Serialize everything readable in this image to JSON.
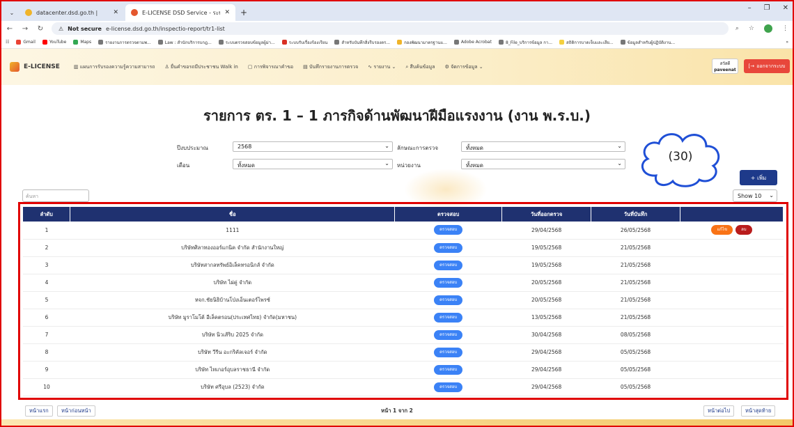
{
  "browser": {
    "tabs": [
      {
        "title": "datacenter.dsd.go.th |",
        "active": false,
        "favicon_color": "#f0b429"
      },
      {
        "title": "E-LICENSE DSD Service - ระบบกำ",
        "active": true,
        "favicon_color": "#e4572e"
      }
    ],
    "new_tab": "+",
    "address": {
      "security": "Not secure",
      "url": "e-license.dsd.go.th/inspectio-report/tr1-list"
    },
    "bookmarks": [
      "Gmail",
      "YouTube",
      "Maps",
      "รายงานการตรวจตามพ...",
      "Law : สำนักบริการบกฎ...",
      "ระบบตรวจสอบข้อมูลผู้ม่า...",
      "ระบบรับเรื่องร้องเรียน",
      "สำหรับบันทึกสิ่งรีบรองตร...",
      "กองพัฒนามาตรฐานแ...",
      "Adobe Acrobat",
      "8_File_บริการข้อมูล กา...",
      "สถิติการบาดเจ็บและเสีย...",
      "ข้อมูลสำหรับผู้ปฏิบัติงาน..."
    ],
    "bookmarks_more": "»"
  },
  "app": {
    "logo": "E-LICENSE",
    "menu": [
      "แผนการรับรองความรู้ความสามารถ",
      "ยื่นคำขอรถมีประชาชน Walk in",
      "การพิจารณาคำขอ",
      "บันทึกรายงานการตรวจ",
      "รายงาน",
      "สืบค้นข้อมูล",
      "จัดการข้อมูล"
    ],
    "user_label": "สวัสดี",
    "user_name": "paveenat",
    "logout": "ออกจากระบบ"
  },
  "page": {
    "title": "รายการ ตร. 1 – 1 ภารกิจด้านพัฒนาฝีมือแรงงาน (งาน พ.ร.บ.)",
    "filters": {
      "year_label": "ปีงบประมาณ",
      "year_value": "2568",
      "type_label": "ลักษณะการตรวจ",
      "type_value": "ทั้งหมด",
      "month_label": "เดือน",
      "month_value": "ทั้งหมด",
      "unit_label": "หน่วยงาน",
      "unit_value": "ทั้งหมด"
    },
    "annotation": "(30)",
    "add_button": "+ เพิ่ม",
    "search_placeholder": "ค้นหา",
    "show": "Show 10"
  },
  "table": {
    "headers": [
      "ลำดับ",
      "ชื่อ",
      "ตรวจสอบ",
      "วันที่ออกตรวจ",
      "วันที่บันทึก",
      ""
    ],
    "check_label": "ตรวจสอบ",
    "edit_label": "แก้ไข",
    "delete_label": "ลบ",
    "rows": [
      {
        "no": "1",
        "name": "1111",
        "inspect_date": "29/04/2568",
        "record_date": "26/05/2568",
        "actions": true
      },
      {
        "no": "2",
        "name": "บริษัทศิลาทองออร์แกนิค จำกัด สำนักงานใหญ่",
        "inspect_date": "19/05/2568",
        "record_date": "21/05/2568",
        "actions": false
      },
      {
        "no": "3",
        "name": "บริษัทสากลทรัพย์อิเล็คทรอนิกส์ จำกัด",
        "inspect_date": "19/05/2568",
        "record_date": "21/05/2568",
        "actions": false
      },
      {
        "no": "4",
        "name": "บริษัท ไผ่คู่ จำกัด",
        "inspect_date": "20/05/2568",
        "record_date": "21/05/2568",
        "actions": false
      },
      {
        "no": "5",
        "name": "หจก.ชัยนิธิบ้านโป่งเอ็นเตอร์ไพรซ์",
        "inspect_date": "20/05/2568",
        "record_date": "21/05/2568",
        "actions": false
      },
      {
        "no": "6",
        "name": "บริษัท มูราโมโต้ อีเล็คตรอน(ประเทศไทย) จำกัด(มหาชน)",
        "inspect_date": "13/05/2568",
        "record_date": "21/05/2568",
        "actions": false
      },
      {
        "no": "7",
        "name": "บริษัท นิวเส้ริบ 2025 จำกัด",
        "inspect_date": "30/04/2568",
        "record_date": "08/05/2568",
        "actions": false
      },
      {
        "no": "8",
        "name": "บริษัท วีรีน อะกริคัลเจอร์ จำกัด",
        "inspect_date": "29/04/2568",
        "record_date": "05/05/2568",
        "actions": false
      },
      {
        "no": "9",
        "name": "บริษัท ไทเกอร์อุบลราชธานี จำกัด",
        "inspect_date": "29/04/2568",
        "record_date": "05/05/2568",
        "actions": false
      },
      {
        "no": "10",
        "name": "บริษัท ศรีอุบล (2523) จำกัด",
        "inspect_date": "29/04/2568",
        "record_date": "05/05/2568",
        "actions": false
      }
    ]
  },
  "pagination": {
    "first": "หน้าแรก",
    "prev": "หน้าก่อนหน้า",
    "info": "หน้า 1 จาก 2",
    "next": "หน้าต่อไป",
    "last": "หน้าสุดท้าย"
  }
}
